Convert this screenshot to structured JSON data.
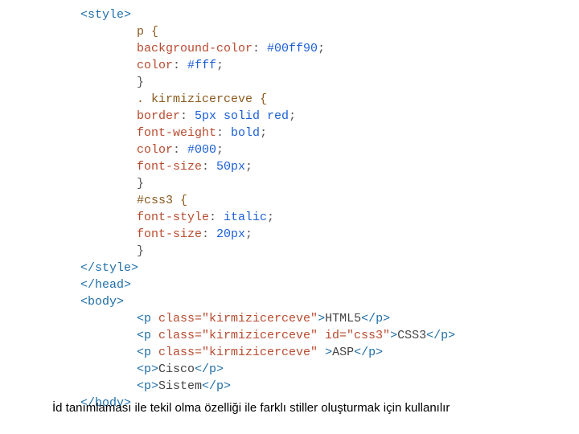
{
  "code": {
    "style_open": "<style>",
    "rule1": {
      "sel": "p {",
      "l1a": "background-color",
      "l1b": ": ",
      "l1c": "#00ff90",
      "l1d": ";",
      "l2a": "color",
      "l2b": ": ",
      "l2c": "#fff",
      "l2d": ";",
      "close": "}"
    },
    "rule2": {
      "sel": ". kirmizicerceve {",
      "l1a": "border",
      "l1b": ": ",
      "l1c": "5px solid red",
      "l1d": ";",
      "l2a": "font-weight",
      "l2b": ": ",
      "l2c": "bold",
      "l2d": ";",
      "l3a": "color",
      "l3b": ": ",
      "l3c": "#000",
      "l3d": ";",
      "l4a": "font-size",
      "l4b": ": ",
      "l4c": "50px",
      "l4d": ";",
      "close": "}"
    },
    "rule3": {
      "sel": "#css3 {",
      "l1a": "font-style",
      "l1b": ": ",
      "l1c": "italic",
      "l1d": ";",
      "l2a": "font-size",
      "l2b": ": ",
      "l2c": "20px",
      "l2d": ";",
      "close": "}"
    },
    "style_close": "</style>",
    "head_close": "</head>",
    "body_open": "<body>",
    "p1": {
      "open": "<p ",
      "attr": "class=\"kirmizicerceve\"",
      "mid": ">",
      "text": "HTML5",
      "close": "</p>"
    },
    "p2": {
      "open": "<p ",
      "attr": "class=\"kirmizicerceve\" id=\"css3\"",
      "mid": ">",
      "text": "CSS3",
      "close": "</p>"
    },
    "p3": {
      "open": "<p ",
      "attr": "class=\"kirmizicerceve\" ",
      "mid": ">",
      "text": "ASP",
      "close": "</p>"
    },
    "p4": {
      "open": "<p>",
      "text": "Cisco",
      "close": "</p>"
    },
    "p5": {
      "open": "<p>",
      "text": "Sistem",
      "close": "</p>"
    },
    "body_close": "</body>"
  },
  "caption": "İd tanımlaması ile tekil olma özelliği ile farklı stiller oluşturmak için kullanılır"
}
